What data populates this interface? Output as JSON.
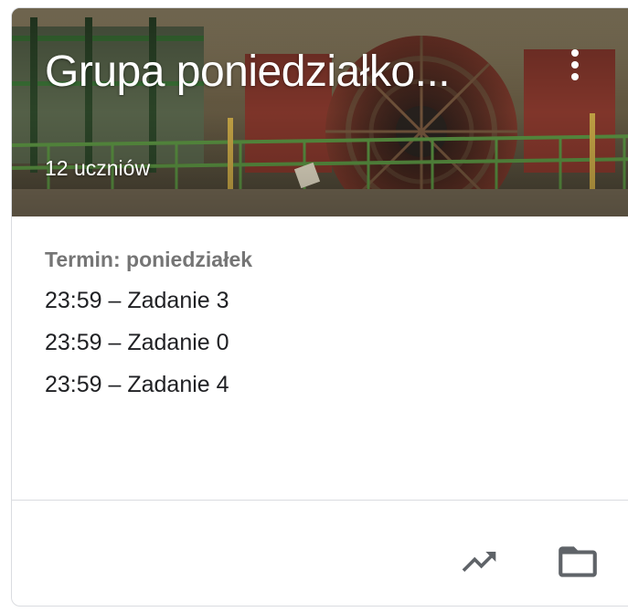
{
  "card": {
    "title": "Grupa poniedziałko...",
    "student_count": "12 uczniów",
    "more_menu_icon": "more-vert-icon",
    "banner_image": "experiment-hall-photo"
  },
  "assignments": {
    "due_label": "Termin: poniedziałek",
    "items": [
      "23:59 – Zadanie 3",
      "23:59 – Zadanie 0",
      "23:59 – Zadanie 4"
    ]
  },
  "footer": {
    "actions": [
      {
        "icon": "trending-up-icon"
      },
      {
        "icon": "folder-icon"
      }
    ]
  },
  "colors": {
    "title_text": "#ffffff",
    "due_label": "#757575",
    "body_text": "#202124",
    "icons": "#5f6368",
    "divider": "#dadce0"
  }
}
